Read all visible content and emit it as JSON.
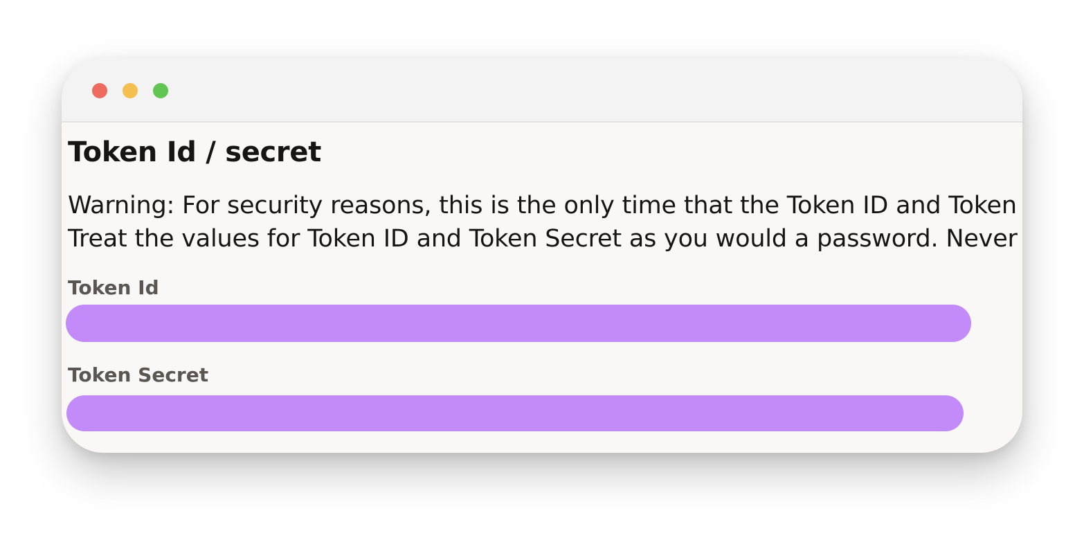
{
  "window": {
    "controls": [
      "close",
      "minimize",
      "maximize"
    ]
  },
  "page": {
    "title": "Token Id / secret",
    "warning_lines": [
      "Warning: For security reasons, this is the only time that the Token ID and Token",
      "Treat the values for Token ID and Token Secret as you would a password. Never"
    ]
  },
  "fields": {
    "token_id_label": "Token Id",
    "token_secret_label": "Token Secret"
  },
  "colors": {
    "redaction": "#c38afa",
    "close": "#ec6a5e",
    "minimize": "#f4bf4f",
    "maximize": "#61c554"
  }
}
